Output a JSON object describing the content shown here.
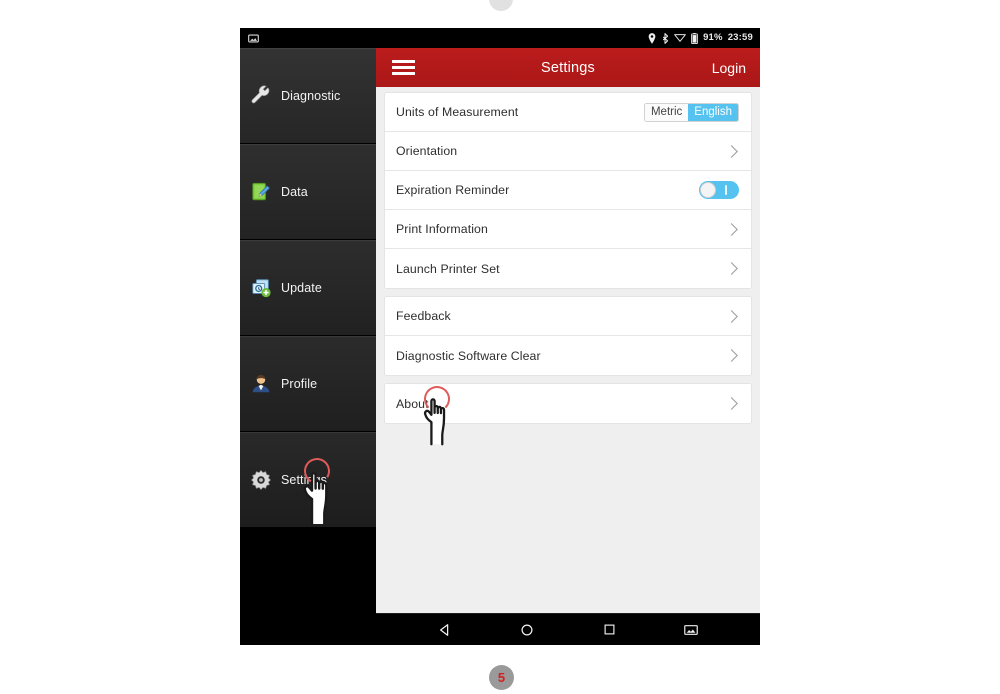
{
  "status_bar": {
    "icons": [
      "image-icon",
      "location-pin-icon",
      "bluetooth-icon",
      "wifi-icon",
      "battery-icon"
    ],
    "battery_percent": "91%",
    "time": "23:59"
  },
  "app_bar": {
    "menu_icon": "hamburger-menu-icon",
    "title": "Settings",
    "login_label": "Login"
  },
  "sidebar": {
    "items": [
      {
        "label": "Diagnostic",
        "icon": "wrench-icon"
      },
      {
        "label": "Data",
        "icon": "notepad-pencil-icon"
      },
      {
        "label": "Update",
        "icon": "update-download-icon"
      },
      {
        "label": "Profile",
        "icon": "person-avatar-icon"
      },
      {
        "label": "Settings",
        "icon": "gear-icon"
      }
    ]
  },
  "settings": {
    "groups": [
      {
        "rows": [
          {
            "label": "Units of Measurement",
            "control": "segmented",
            "options": [
              "Metric",
              "English"
            ],
            "selected": "English"
          },
          {
            "label": "Orientation",
            "control": "chevron"
          },
          {
            "label": "Expiration Reminder",
            "control": "toggle",
            "value": "on"
          },
          {
            "label": "Print Information",
            "control": "chevron"
          },
          {
            "label": "Launch Printer Set",
            "control": "chevron"
          }
        ]
      },
      {
        "rows": [
          {
            "label": "Feedback",
            "control": "chevron"
          },
          {
            "label": "Diagnostic Software Clear",
            "control": "chevron"
          }
        ]
      },
      {
        "rows": [
          {
            "label": "About",
            "control": "chevron"
          }
        ]
      }
    ]
  },
  "nav_bar": {
    "buttons": [
      "back-triangle-icon",
      "home-circle-icon",
      "recents-square-icon",
      "screenshot-icon"
    ]
  },
  "annotations": {
    "page_number": "5",
    "cursor_settings": "hand-cursor-icon",
    "cursor_about": "hand-cursor-icon",
    "tap_highlight_color": "#e05b5b"
  },
  "colors": {
    "app_bar_red": "#b4191b",
    "accent_blue": "#56c2ef",
    "panel_bg": "#efefef",
    "sidebar_bg": "#0c0c0c",
    "badge_red": "#d32020"
  }
}
